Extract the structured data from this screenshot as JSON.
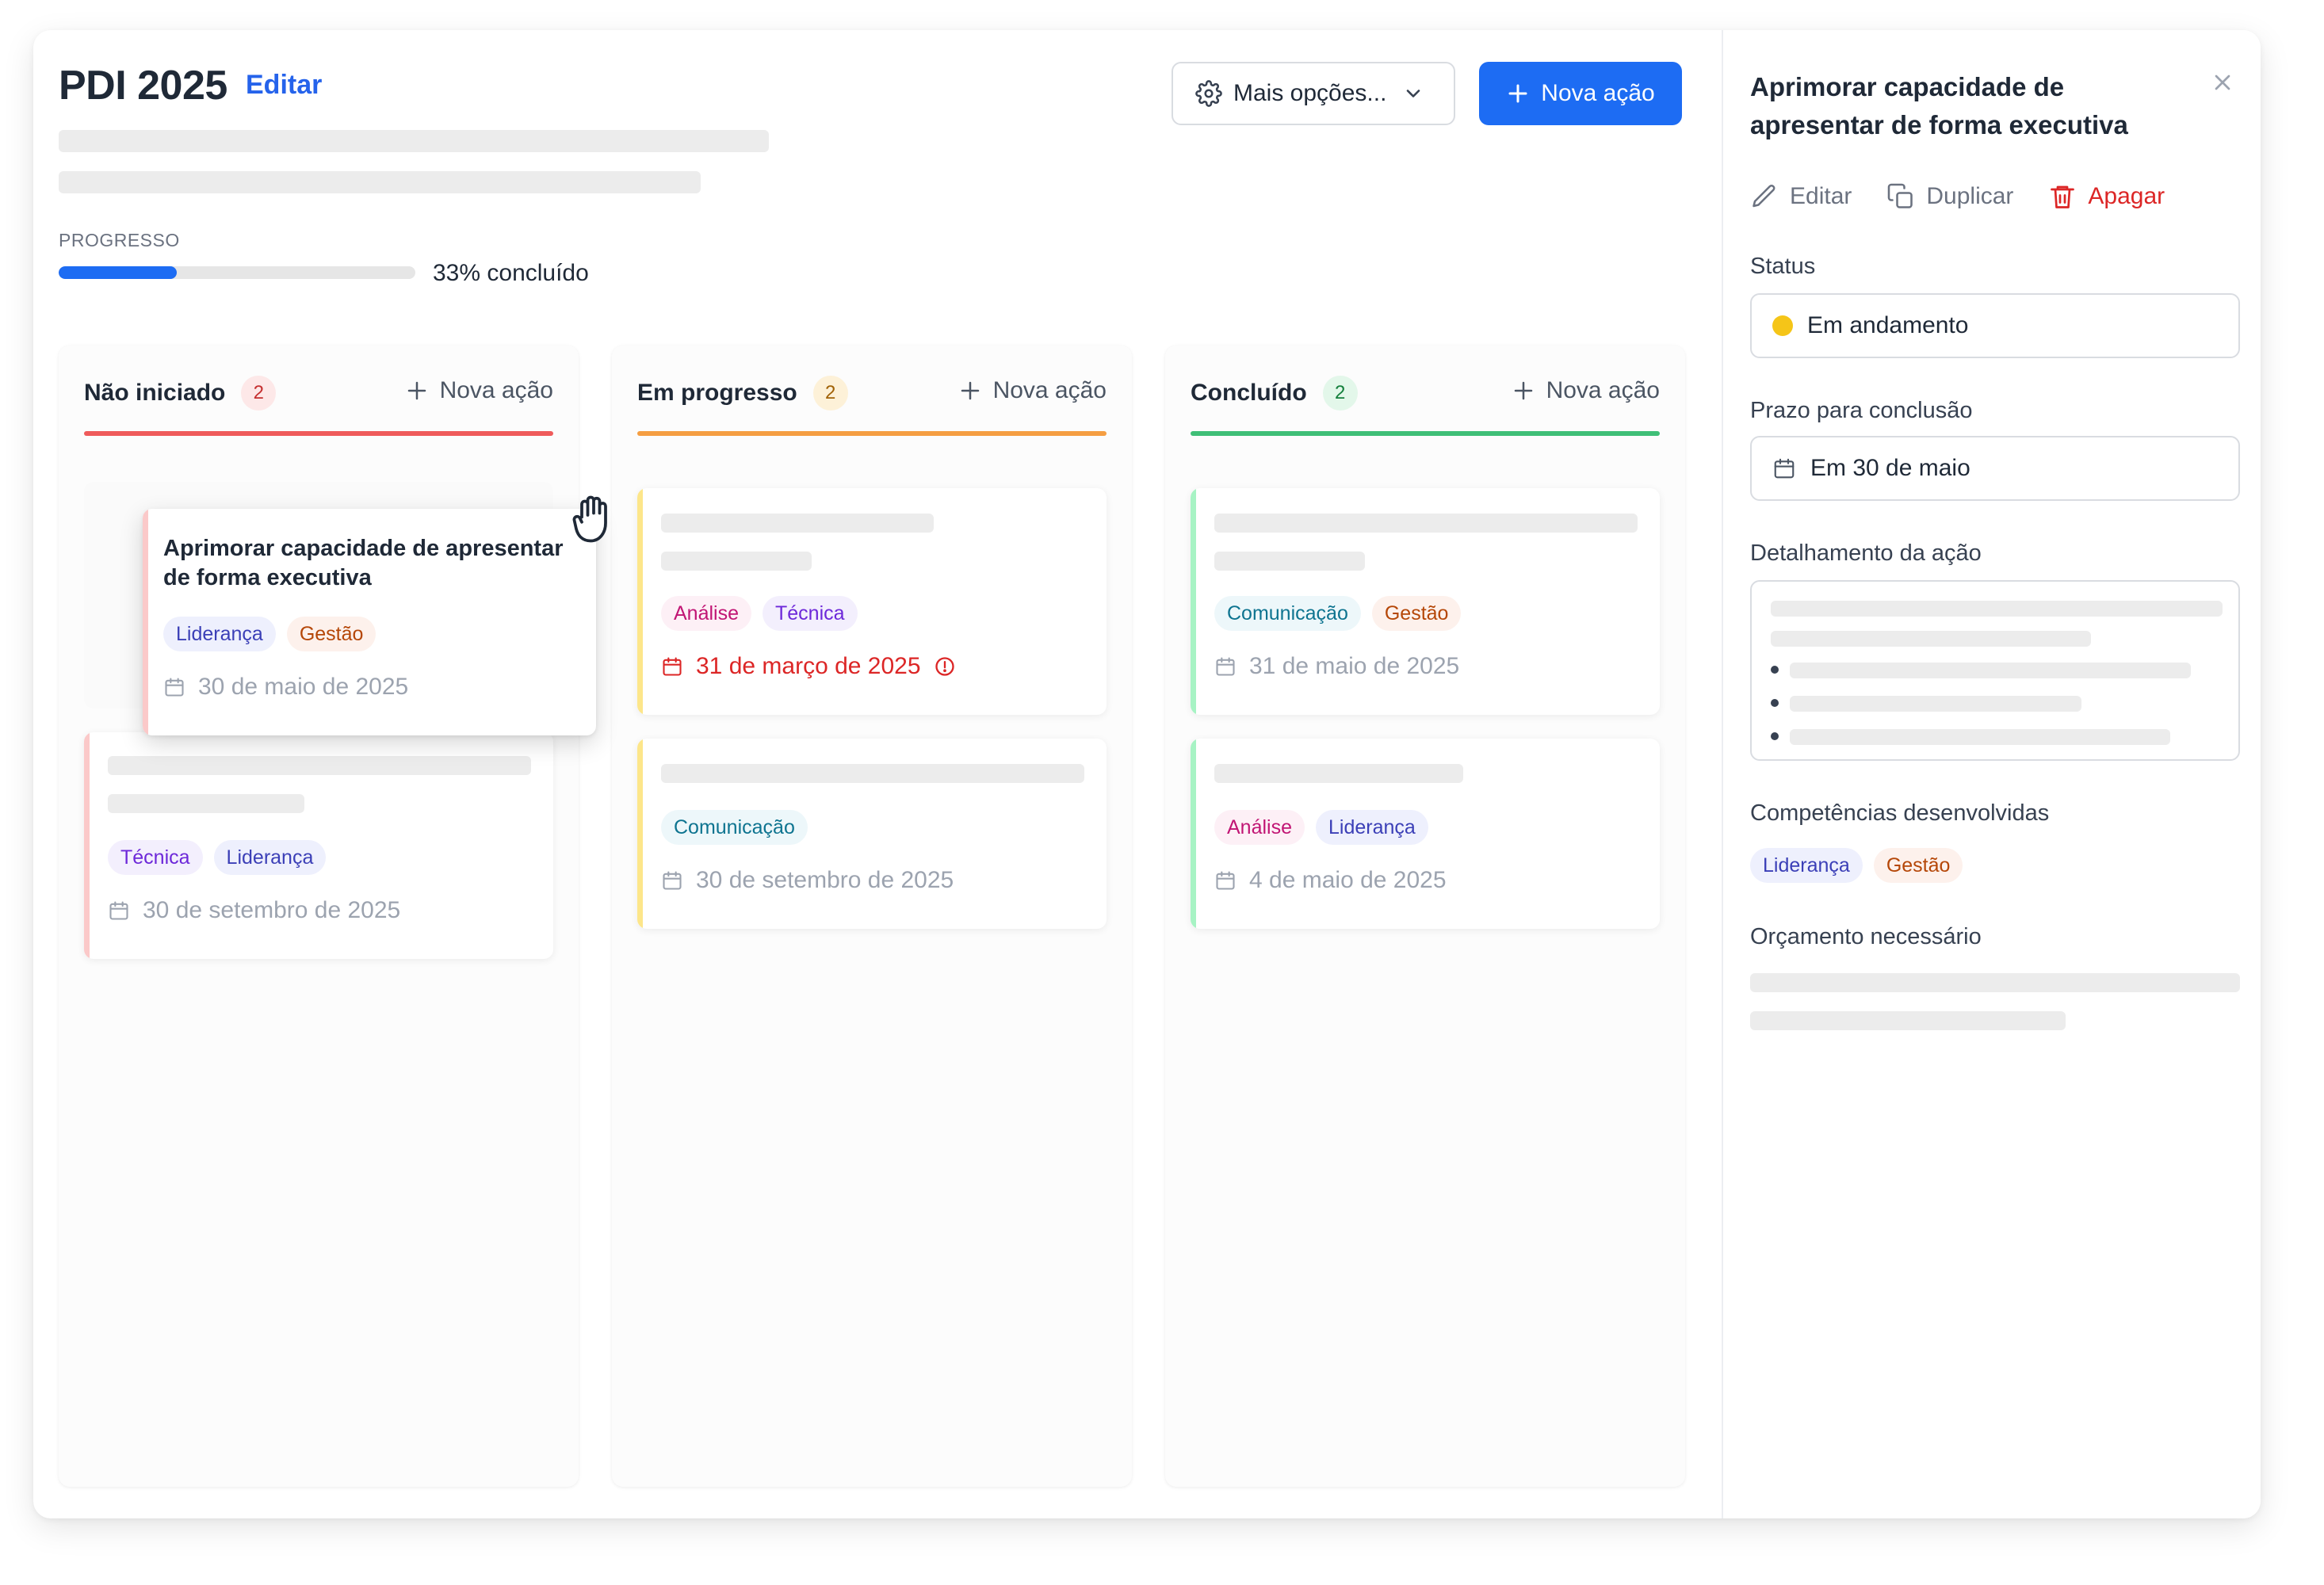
{
  "page": {
    "title": "PDI 2025",
    "edit_label": "Editar",
    "options_label": "Mais opções...",
    "new_action_label": "Nova ação",
    "progress_label": "PROGRESSO",
    "progress_text": "33% concluído",
    "progress_fraction": 0.33
  },
  "columns": [
    {
      "title": "Não iniciado",
      "count": "2",
      "add_label": "Nova ação",
      "accent": "#ef5b5b",
      "badge_bg": "#fde8e8",
      "badge_fg": "#c53030",
      "stripe": "#fbc9c9",
      "cards": [
        {
          "title": "Aprimorar capacidade de apresentar de forma executiva",
          "tags": [
            "Liderança",
            "Gestão"
          ],
          "date": "30 de maio de 2025"
        },
        {
          "tags": [
            "Técnica",
            "Liderança"
          ],
          "date": "30 de setembro de 2025"
        }
      ]
    },
    {
      "title": "Em progresso",
      "count": "2",
      "add_label": "Nova ação",
      "accent": "#f59e42",
      "badge_bg": "#fdf1d8",
      "badge_fg": "#a16207",
      "stripe": "#fde68a",
      "cards": [
        {
          "tags": [
            "Análise",
            "Técnica"
          ],
          "date": "31 de março de 2025",
          "overdue": true
        },
        {
          "tags": [
            "Comunicação"
          ],
          "date": "30 de setembro de 2025"
        }
      ]
    },
    {
      "title": "Concluído",
      "count": "2",
      "add_label": "Nova ação",
      "accent": "#3fbf77",
      "badge_bg": "#e3f7ea",
      "badge_fg": "#15803d",
      "stripe": "#a7f3c4",
      "cards": [
        {
          "tags": [
            "Comunicação",
            "Gestão"
          ],
          "date": "31 de maio de 2025"
        },
        {
          "tags": [
            "Análise",
            "Liderança"
          ],
          "date": "4 de maio de 2025"
        }
      ]
    }
  ],
  "panel": {
    "title": "Aprimorar capacidade de apresentar de forma executiva",
    "actions": {
      "edit": "Editar",
      "duplicate": "Duplicar",
      "delete": "Apagar"
    },
    "status_label": "Status",
    "status_value": "Em andamento",
    "status_color": "#f5c518",
    "deadline_label": "Prazo para conclusão",
    "deadline_value": "Em 30 de maio",
    "detail_label": "Detalhamento da ação",
    "skills_label": "Competências desenvolvidas",
    "skills": [
      "Liderança",
      "Gestão"
    ],
    "budget_label": "Orçamento necessário"
  },
  "colors": {
    "primary": "#1d6cf3",
    "danger": "#dc2626"
  }
}
